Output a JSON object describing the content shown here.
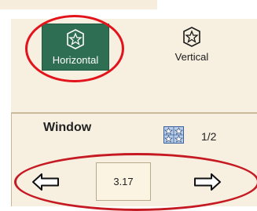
{
  "orientation": {
    "horizontal": {
      "label": "Horizontal",
      "icon": "star-badge-icon",
      "selected": true
    },
    "vertical": {
      "label": "Vertical",
      "icon": "star-badge-icon",
      "selected": false
    }
  },
  "window": {
    "title": "Window",
    "pager_icon": "star-grid-icon",
    "page_indicator": "1/2",
    "value": "3.17",
    "prev_icon": "left-arrow-icon",
    "next_icon": "right-arrow-icon"
  },
  "annotations": {
    "highlight_color": "#e3131c"
  },
  "colors": {
    "accent": "#2e6e52",
    "panel_bg": "#f7efe0"
  }
}
